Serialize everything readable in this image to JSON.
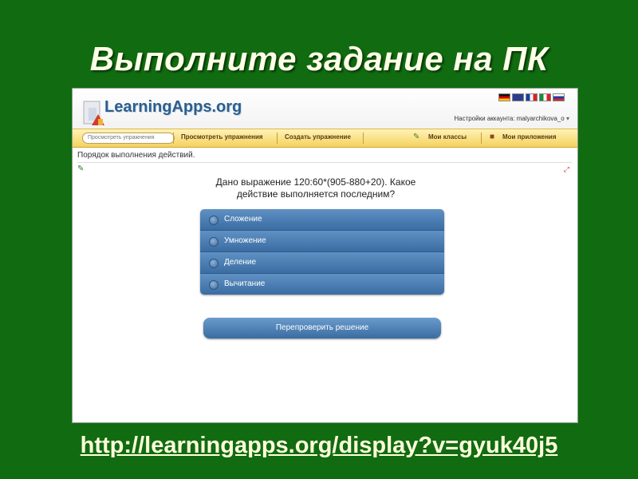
{
  "slide": {
    "title": "Выполните задание на ПК",
    "url": "http://learningapps.org/display?v=gyuk40j5"
  },
  "app": {
    "logo": "LearningApps.org",
    "account": "Настройки аккаунта: malyarchikova_o",
    "flags": [
      "de",
      "gb",
      "fr",
      "it",
      "ru"
    ]
  },
  "nav": {
    "search_placeholder": "Просмотреть упражнения",
    "items": [
      "Просмотреть упражнения",
      "Создать упражнение",
      "Мои классы",
      "Мои приложения"
    ]
  },
  "task": {
    "title": "Порядок выполнения действий.",
    "question_line1": "Дано выражение 120:60*(905-880+20). Какое",
    "question_line2": "действие выполняется последним?",
    "answers": [
      "Сложение",
      "Умножение",
      "Деление",
      "Вычитание"
    ],
    "check_button": "Перепроверить решение"
  },
  "colors": {
    "slide_bg": "#116b11",
    "answer_blue": "#4a7db3",
    "nav_yellow": "#f4d25c"
  }
}
